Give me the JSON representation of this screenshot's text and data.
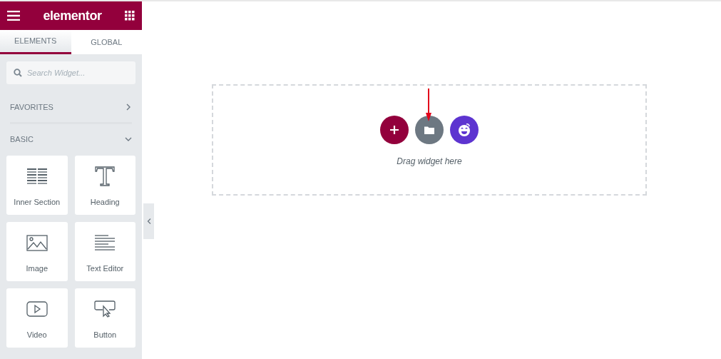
{
  "header": {
    "logo": "elementor"
  },
  "tabs": [
    {
      "label": "ELEMENTS",
      "selected": true
    },
    {
      "label": "GLOBAL",
      "selected": false
    }
  ],
  "search": {
    "placeholder": "Search Widget..."
  },
  "categories": [
    {
      "label": "FAVORITES",
      "expanded": false
    },
    {
      "label": "BASIC",
      "expanded": true
    }
  ],
  "widgets": [
    {
      "label": "Inner Section",
      "kind": "columns"
    },
    {
      "label": "Heading",
      "kind": "heading"
    },
    {
      "label": "Image",
      "kind": "image"
    },
    {
      "label": "Text Editor",
      "kind": "text"
    },
    {
      "label": "Video",
      "kind": "video"
    },
    {
      "label": "Button",
      "kind": "button"
    }
  ],
  "canvas": {
    "drop_hint": "Drag widget here"
  }
}
